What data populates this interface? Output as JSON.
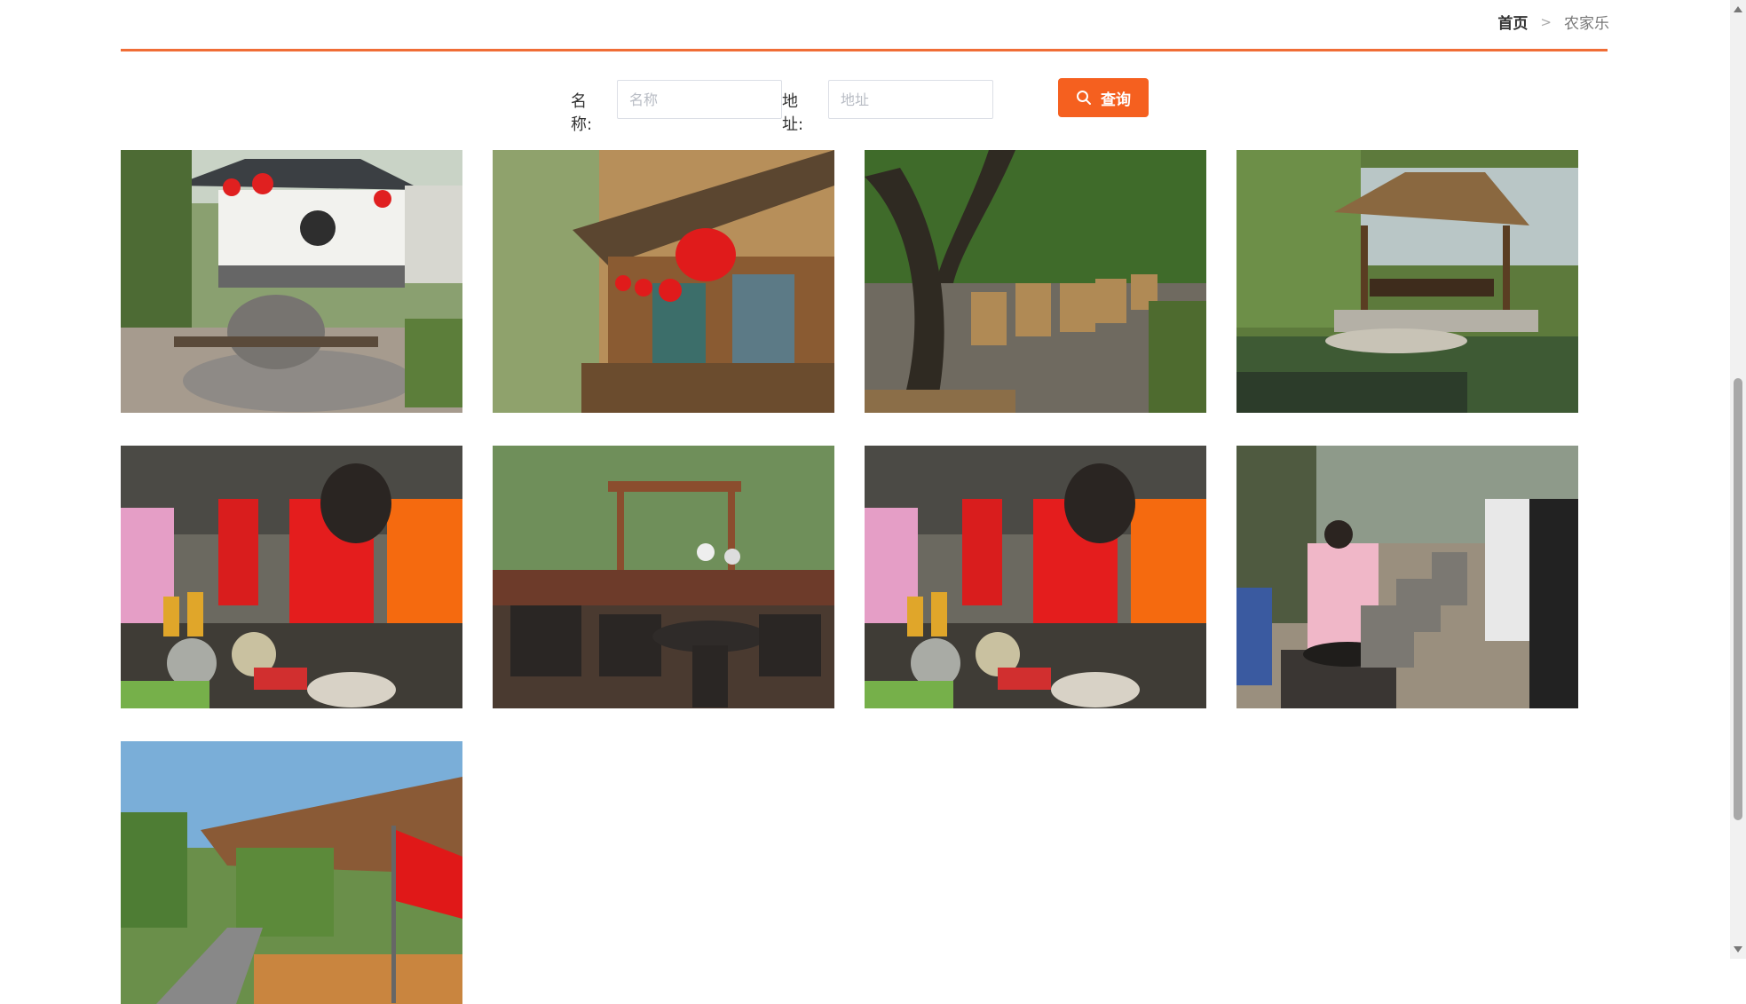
{
  "breadcrumb": {
    "home": "首页",
    "separator": ">",
    "current": "农家乐"
  },
  "search": {
    "name_label": "名称:",
    "name_placeholder": "名称",
    "name_value": "",
    "address_label": "地址:",
    "address_placeholder": "地址",
    "address_value": "",
    "button_label": "查询",
    "button_icon": "search-icon"
  },
  "colors": {
    "accent": "#f5601f",
    "divider": "#f06d36"
  },
  "photos": [
    {
      "name": "photo-stone-mill-courtyard"
    },
    {
      "name": "photo-lantern-corridor"
    },
    {
      "name": "photo-tree-shaded-tables"
    },
    {
      "name": "photo-thatched-pavilion-pond"
    },
    {
      "name": "photo-outdoor-cooking-table"
    },
    {
      "name": "photo-terrace-seating"
    },
    {
      "name": "photo-outdoor-cooking-table-2"
    },
    {
      "name": "photo-outdoor-wok-stoves"
    },
    {
      "name": "photo-farmhouse-entrance"
    }
  ]
}
